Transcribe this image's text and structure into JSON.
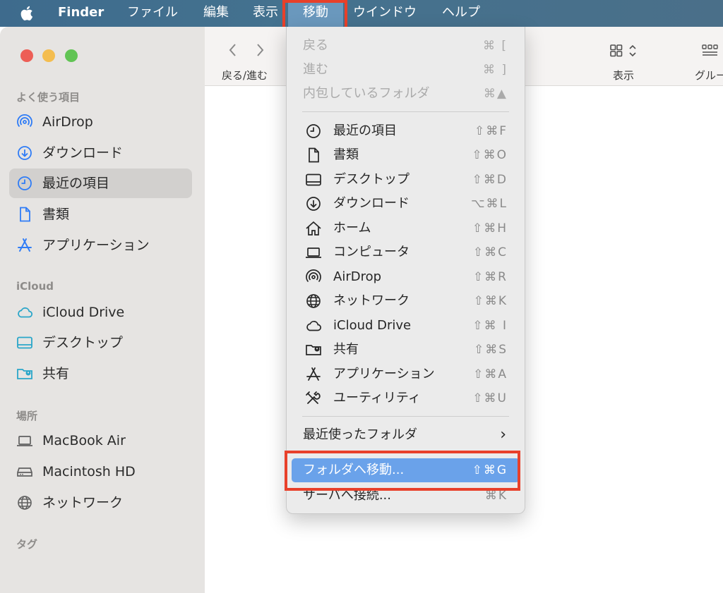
{
  "menubar": {
    "app": "Finder",
    "items": [
      "ファイル",
      "編集",
      "表示",
      "移動",
      "ウインドウ",
      "ヘルプ"
    ],
    "active": "移動"
  },
  "toolbar": {
    "nav_label": "戻る/進む",
    "view_label": "表示",
    "group_label": "グルー"
  },
  "sidebar": {
    "favorites_title": "よく使う項目",
    "favorites": [
      {
        "label": "AirDrop",
        "icon": "airdrop-icon"
      },
      {
        "label": "ダウンロード",
        "icon": "download-icon"
      },
      {
        "label": "最近の項目",
        "icon": "clock-icon",
        "selected": true
      },
      {
        "label": "書類",
        "icon": "document-icon"
      },
      {
        "label": "アプリケーション",
        "icon": "applications-icon"
      }
    ],
    "icloud_title": "iCloud",
    "icloud": [
      {
        "label": "iCloud Drive",
        "icon": "cloud-icon"
      },
      {
        "label": "デスクトップ",
        "icon": "desktop-icon"
      },
      {
        "label": "共有",
        "icon": "shared-folder-icon"
      }
    ],
    "locations_title": "場所",
    "locations": [
      {
        "label": "MacBook Air",
        "icon": "laptop-icon"
      },
      {
        "label": "Macintosh HD",
        "icon": "drive-icon"
      },
      {
        "label": "ネットワーク",
        "icon": "globe-icon"
      }
    ],
    "tags_title": "タグ"
  },
  "menu": {
    "top": [
      {
        "label": "戻る",
        "shortcut": "⌘ [",
        "disabled": true
      },
      {
        "label": "進む",
        "shortcut": "⌘ ]",
        "disabled": true
      },
      {
        "label": "内包しているフォルダ",
        "shortcut": "⌘▲",
        "disabled": true
      }
    ],
    "places": [
      {
        "label": "最近の項目",
        "shortcut": "⇧⌘F",
        "icon": "clock-icon"
      },
      {
        "label": "書類",
        "shortcut": "⇧⌘O",
        "icon": "document-icon"
      },
      {
        "label": "デスクトップ",
        "shortcut": "⇧⌘D",
        "icon": "desktop-icon"
      },
      {
        "label": "ダウンロード",
        "shortcut": "⌥⌘L",
        "icon": "download-icon"
      },
      {
        "label": "ホーム",
        "shortcut": "⇧⌘H",
        "icon": "home-icon"
      },
      {
        "label": "コンピュータ",
        "shortcut": "⇧⌘C",
        "icon": "laptop-icon"
      },
      {
        "label": "AirDrop",
        "shortcut": "⇧⌘R",
        "icon": "airdrop-icon"
      },
      {
        "label": "ネットワーク",
        "shortcut": "⇧⌘K",
        "icon": "globe-icon"
      },
      {
        "label": "iCloud Drive",
        "shortcut": "⇧⌘ I",
        "icon": "cloud-icon"
      },
      {
        "label": "共有",
        "shortcut": "⇧⌘S",
        "icon": "shared-folder-icon"
      },
      {
        "label": "アプリケーション",
        "shortcut": "⇧⌘A",
        "icon": "applications-icon"
      },
      {
        "label": "ユーティリティ",
        "shortcut": "⇧⌘U",
        "icon": "utilities-icon"
      }
    ],
    "recent_folders": {
      "label": "最近使ったフォルダ",
      "submenu_arrow": "›"
    },
    "goto_folder": {
      "label": "フォルダへ移動...",
      "shortcut": "⇧⌘G",
      "highlighted": true
    },
    "connect_server": {
      "label": "サーバへ接続...",
      "shortcut": "⌘K"
    }
  },
  "colors": {
    "highlight": "#e8402a",
    "selection": "#6aa2ea",
    "menubar": "#44728f"
  }
}
